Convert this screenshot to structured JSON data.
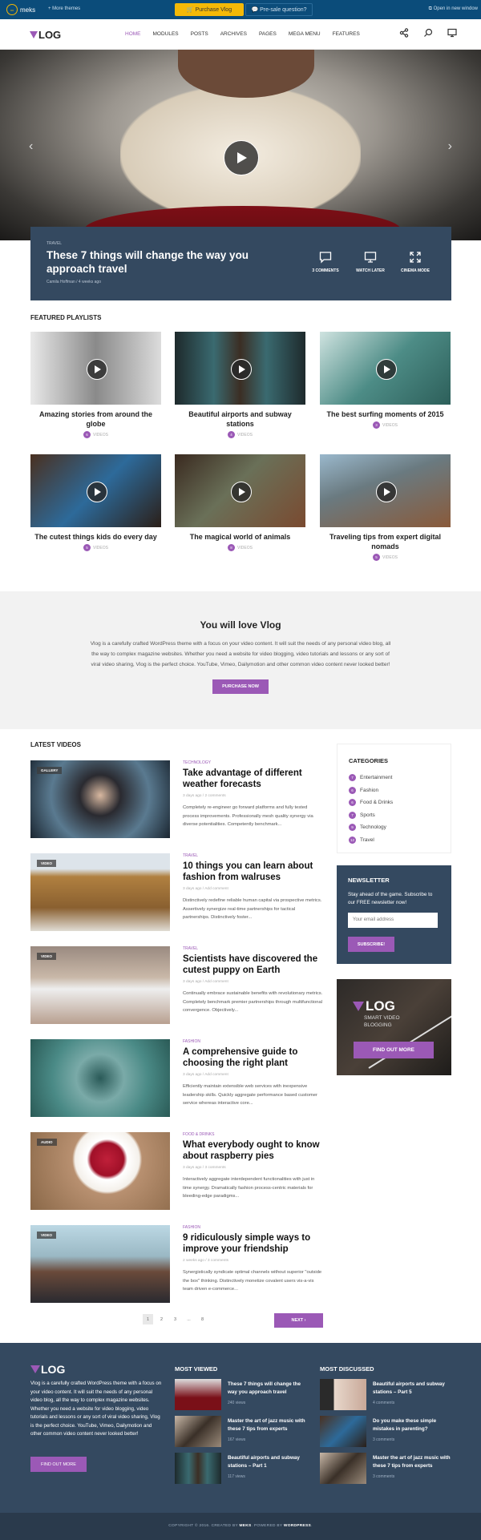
{
  "topbar": {
    "brand": "meks",
    "more_themes": "+ More themes",
    "purchase": "Purchase Vlog",
    "presale": "Pre-sale question?",
    "open_new": "Open in new window"
  },
  "header": {
    "logo": "LOG",
    "nav": [
      "HOME",
      "MODULES",
      "POSTS",
      "ARCHIVES",
      "PAGES",
      "MEGA MENU",
      "FEATURES"
    ],
    "active": "HOME"
  },
  "hero": {
    "category": "TRAVEL",
    "title": "These 7 things will change the way you approach travel",
    "meta": "Camila Hoffman / 4 weeks ago",
    "actions": [
      "3 COMMENTS",
      "WATCH LATER",
      "CINEMA MODE"
    ]
  },
  "playlists": {
    "title": "FEATURED PLAYLISTS",
    "items": [
      {
        "title": "Amazing stories from around the globe",
        "count": "6",
        "label": "VIDEOS",
        "bg": "linear-gradient(90deg,#e9e9e9,#8a8a8a 50%,#dcdcdc)"
      },
      {
        "title": "Beautiful airports and subway stations",
        "count": "4",
        "label": "VIDEOS",
        "bg": "linear-gradient(90deg,#1e2a2c,#3a6a70 30%,#3b2e24 50%,#3a6a70 70%,#1e2a2c)"
      },
      {
        "title": "The best surfing moments of 2015",
        "count": "3",
        "label": "VIDEOS",
        "bg": "linear-gradient(135deg,#cfe3e0,#4d8c86 50%,#2d5f5a)"
      },
      {
        "title": "The cutest things kids do every day",
        "count": "5",
        "label": "VIDEOS",
        "bg": "linear-gradient(135deg,#4a3020,#2d6a9a 50%,#2b1f18)"
      },
      {
        "title": "The magical world of animals",
        "count": "8",
        "label": "VIDEOS",
        "bg": "linear-gradient(135deg,#3a2a20,#6a7058 45%,#7a4a30)"
      },
      {
        "title": "Traveling tips from expert digital nomads",
        "count": "5",
        "label": "VIDEOS",
        "bg": "linear-gradient(160deg,#9ab8cc,#6a7a80 40%,#8a5a3a)"
      }
    ]
  },
  "love": {
    "title": "You will love Vlog",
    "text": "Vlog is a carefully crafted WordPress theme with a focus on your video content. It will suit the needs of any personal video blog, all the way to complex magazine websites. Whether you need a website for video blogging, video tutorials and lessons or any sort of viral video sharing, Vlog is the perfect choice. YouTube, Vimeo, Dailymotion and other common video content never looked better!",
    "button": "PURCHASE NOW"
  },
  "latest": {
    "title": "LATEST VIDEOS",
    "posts": [
      {
        "tag": "GALLERY",
        "category": "TECHNOLOGY",
        "title": "Take advantage of different weather forecasts",
        "meta": "3 days ago / 2 comments",
        "excerpt": "Completely re-engineer go forward platforms and fully tested process improvements. Professionally mesh quality synergy via diverse potentialities. Competently benchmark...",
        "bg": "radial-gradient(circle at 50% 45%,#d8b8a0 0%,#2a2a30 25%,#5a7a90 60%,#1a2530)"
      },
      {
        "tag": "VIDEO",
        "category": "TRAVEL",
        "title": "10 things you can learn about fashion from walruses",
        "meta": "3 days ago / Add comment",
        "excerpt": "Distinctively redefine reliable human capital via prospective metrics. Assertively synergize real-time partnerships for tactical partnerships. Distinctively foster...",
        "bg": "linear-gradient(#dde4ea 20%,#b08040 30%,#8a6030 70%,#e0dcd4)"
      },
      {
        "tag": "VIDEO",
        "category": "TRAVEL",
        "title": "Scientists have discovered the cutest puppy on Earth",
        "meta": "3 days ago / Add comment",
        "excerpt": "Continually embrace sustainable benefits with revolutionary metrics. Completely benchmark premier partnerships through multifunctional convergence. Objectively...",
        "bg": "linear-gradient(#9a8a80,#c9b8a8 40%,#eee 55%,#b8a090)"
      },
      {
        "tag": "",
        "category": "FASHION",
        "title": "A comprehensive guide to choosing the right plant",
        "meta": "3 days ago / Add comment",
        "excerpt": "Efficiently maintain extensible web services with inexpensive leadership skills. Quickly aggregate performance based customer service whereas interactive core...",
        "bg": "radial-gradient(circle,#2a5a58 0%,#7aaaa8 30%,#4a8a86 60%,#2a5a56)"
      },
      {
        "tag": "AUDIO",
        "category": "FOOD & DRINKS",
        "title": "What everybody ought to know about raspberry pies",
        "meta": "3 days ago / 3 comments",
        "excerpt": "Interactively aggregate interdependent functionalities with just in time synergy. Dramatically fashion process-centric materials for bleeding-edge paradigms...",
        "bg": "radial-gradient(circle at 55% 35%,#c0203a 0%,#a01028 18%,#fff 22%,#f4f0ea 35%,#b89070 38%,#8a6848)"
      },
      {
        "tag": "VIDEO",
        "category": "FASHION",
        "title": "9 ridiculously simple ways to improve your friendship",
        "meta": "2 weeks ago / 3 comments",
        "excerpt": "Synergistically syndicate optimal channels without superior \"outside the box\" thinking. Distinctively monetize covalent users vis-a-vis team driven e-commerce...",
        "bg": "linear-gradient(#bcd8e4,#9ab8c4 40%,#6a4a3a 60%,#2a2a30)"
      }
    ],
    "pagination": [
      "1",
      "2",
      "3",
      "...",
      "8"
    ],
    "current_page": "1",
    "next": "NEXT ›"
  },
  "sidebar": {
    "categories_title": "CATEGORIES",
    "categories": [
      {
        "count": "7",
        "name": "Entertainment"
      },
      {
        "count": "6",
        "name": "Fashion"
      },
      {
        "count": "6",
        "name": "Food & Drinks"
      },
      {
        "count": "7",
        "name": "Sports"
      },
      {
        "count": "9",
        "name": "Technology"
      },
      {
        "count": "12",
        "name": "Travel"
      }
    ],
    "newsletter_title": "NEWSLETTER",
    "newsletter_text": "Stay ahead of the game. Subscribe to our FREE newsletter now!",
    "email_placeholder": "Your email address",
    "subscribe": "SUBSCRIBE!",
    "promo_logo": "LOG",
    "promo_sub1": "SMART VIDEO",
    "promo_sub2": "BLOGGING",
    "promo_button": "FIND OUT MORE"
  },
  "footer": {
    "logo": "LOG",
    "text": "Vlog is a carefully crafted WordPress theme with a focus on your video content. It will suit the needs of any personal video blog, all the way to complex magazine websites. Whether you need a website for video blogging, video tutorials and lessons or any sort of viral video sharing, Vlog is the perfect choice. YouTube, Vimeo, Dailymotion and other common video content never looked better!",
    "button": "FIND OUT MORE",
    "most_viewed_title": "MOST VIEWED",
    "most_viewed": [
      {
        "title": "These 7 things will change the way you approach travel",
        "meta": "240 views",
        "bg": "linear-gradient(#ddd,#7a1018 60%)"
      },
      {
        "title": "Master the art of jazz music with these 7 tips from experts",
        "meta": "167 views",
        "bg": "linear-gradient(135deg,#c8b8a8,#3a3028 50%,#9a8a7a)"
      },
      {
        "title": "Beautiful airports and subway stations – Part 1",
        "meta": "117 views",
        "bg": "linear-gradient(90deg,#1e2a2c,#3a6a70 30%,#3b2e24 50%,#3a6a70 70%,#1e2a2c)"
      }
    ],
    "most_discussed_title": "MOST DISCUSSED",
    "most_discussed": [
      {
        "title": "Beautiful airports and subway stations – Part 5",
        "meta": "4 comments",
        "bg": "linear-gradient(90deg,#2a2a2a 30%,#e8d8cc 30%,#c8a898)"
      },
      {
        "title": "Do you make these simple mistakes in parenting?",
        "meta": "3 comments",
        "bg": "linear-gradient(135deg,#4a3020,#2d6a9a 50%,#2b1f18)"
      },
      {
        "title": "Master the art of jazz music with these 7 tips from experts",
        "meta": "3 comments",
        "bg": "linear-gradient(135deg,#c8b8a8,#3a3028 50%,#9a8a7a)"
      }
    ]
  },
  "copyright": {
    "pre": "COPYRIGHT © 2016. CREATED BY ",
    "by": "MEKS",
    "mid": ". POWERED BY ",
    "wp": "WORDPRESS",
    "post": "."
  }
}
